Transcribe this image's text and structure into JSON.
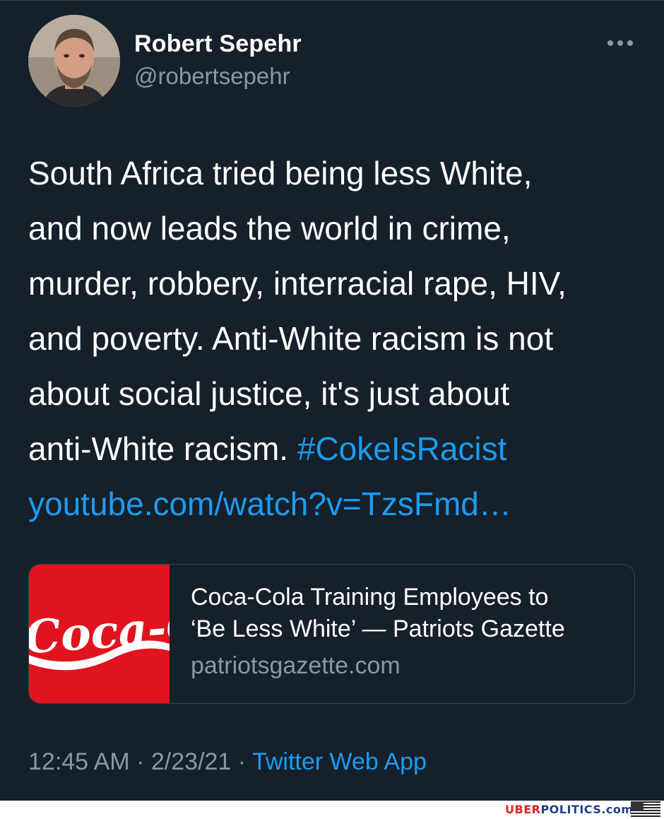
{
  "tweet": {
    "author_name": "Robert Sepehr",
    "author_handle": "@robertsepehr",
    "more_icon": "more-horizontal-icon",
    "text_lines": [
      "South Africa tried being less White,",
      "and now leads the world in crime,",
      "murder, robbery, interracial rape, HIV,",
      "and poverty. Anti-White racism is not",
      "about social justice, it's just about",
      "anti-White racism. "
    ],
    "hashtag": "#CokeIsRacist",
    "url": "youtube.com/watch?v=TzsFmd…",
    "card": {
      "logo_text": "Coca-Cola",
      "title_line1": "Coca-Cola Training Employees to",
      "title_line2": "‘Be Less White’ — Patriots Gazette",
      "domain": "patriotsgazette.com"
    },
    "time": "12:45 AM",
    "date": "2/23/21",
    "separator": "·",
    "source": "Twitter Web App"
  },
  "footer": {
    "brand_part1": "UBER",
    "brand_part2": "POLITICS.com",
    "flag_icon": "us-flag-icon"
  },
  "colors": {
    "background": "#15202b",
    "link": "#1d9bf0",
    "secondary_text": "#8899a6",
    "card_red": "#e0141e"
  }
}
